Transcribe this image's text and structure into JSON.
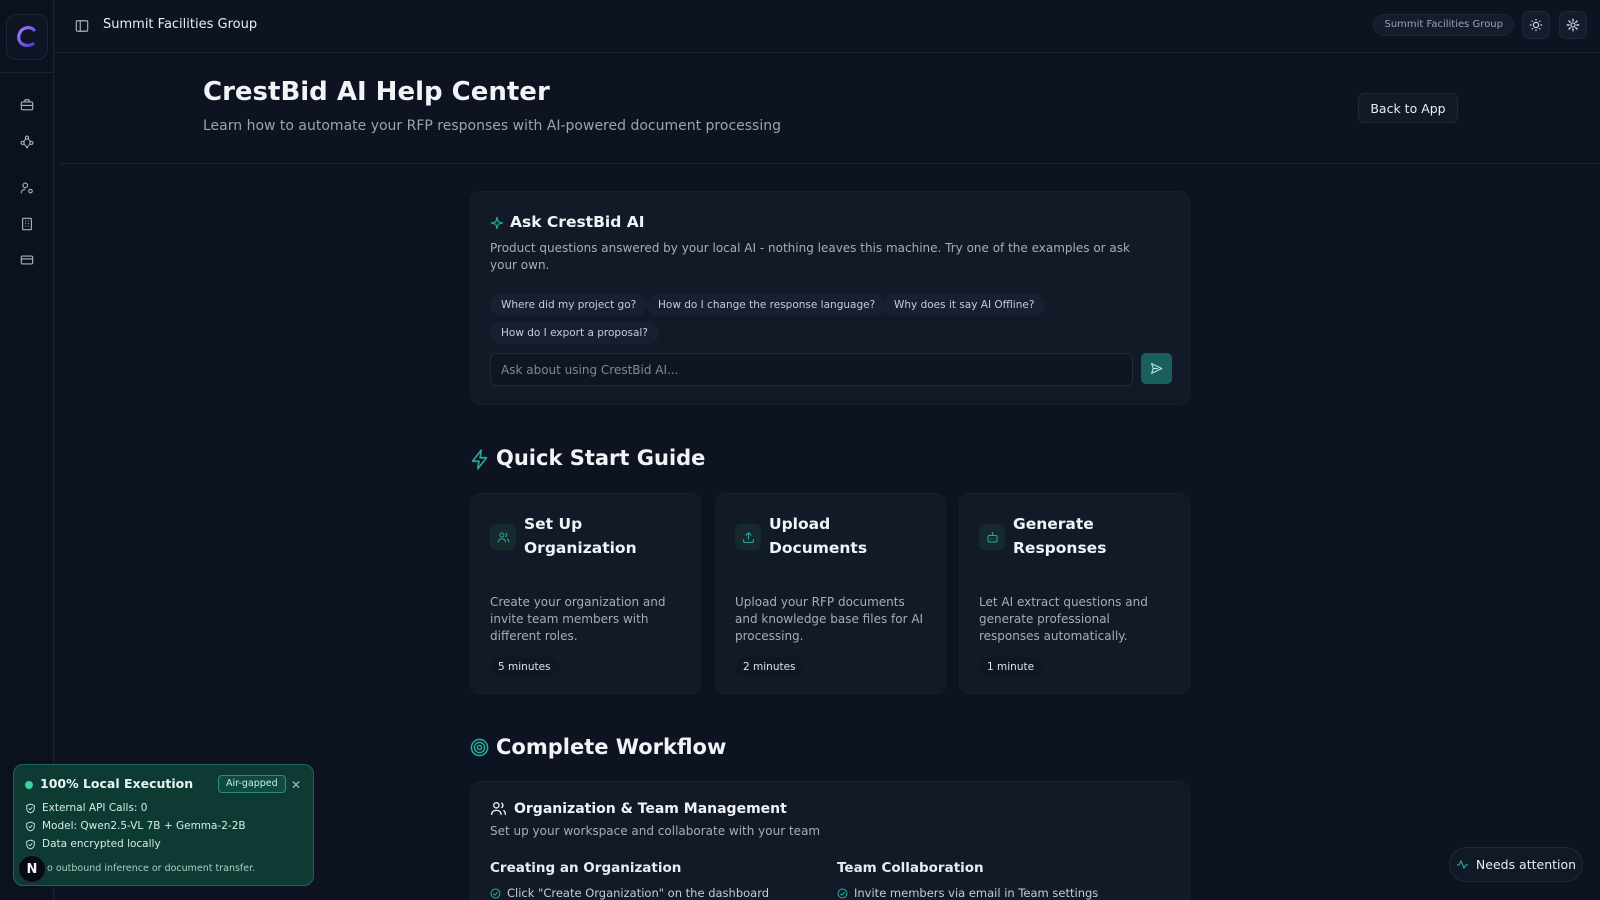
{
  "header": {
    "org_title": "Summit Facilities Group",
    "org_pill": "Summit Facilities Group"
  },
  "page": {
    "title": "CrestBid AI Help Center",
    "subtitle": "Learn how to automate your RFP responses with AI-powered document processing",
    "back_label": "Back to App"
  },
  "ask": {
    "title": "Ask CrestBid AI",
    "description": "Product questions answered by your local AI - nothing leaves this machine. Try one of the examples or ask your own.",
    "chips": [
      "Where did my project go?",
      "How do I change the response language?",
      "Why does it say AI Offline?",
      "How do I export a proposal?"
    ],
    "placeholder": "Ask about using CrestBid AI..."
  },
  "quick_start": {
    "heading": "Quick Start Guide",
    "steps": [
      {
        "title": "Set Up Organization",
        "description": "Create your organization and invite team members with different roles.",
        "time": "5 minutes",
        "icon": "users-icon"
      },
      {
        "title": "Upload Documents",
        "description": "Upload your RFP documents and knowledge base files for AI processing.",
        "time": "2 minutes",
        "icon": "upload-icon"
      },
      {
        "title": "Generate Responses",
        "description": "Let AI extract questions and generate professional responses automatically.",
        "time": "1 minute",
        "icon": "bot-icon"
      }
    ]
  },
  "workflow": {
    "heading": "Complete Workflow",
    "card_title": "Organization & Team Management",
    "card_subtitle": "Set up your workspace and collaborate with your team",
    "columns": [
      {
        "heading": "Creating an Organization",
        "item": "Click \"Create Organization\" on the dashboard"
      },
      {
        "heading": "Team Collaboration",
        "item": "Invite members via email in Team settings"
      }
    ]
  },
  "local_exec": {
    "title": "100% Local Execution",
    "badge": "Air-gapped",
    "rows": [
      "External API Calls: 0",
      "Model: Qwen2.5-VL 7B + Gemma-2-2B",
      "Data encrypted locally"
    ],
    "note": "o outbound inference or document transfer.",
    "avatar_letter": "N"
  },
  "attention": {
    "label": "Needs attention"
  },
  "colors": {
    "background": "#0d1321",
    "card": "#121a28",
    "accent_teal": "#2aa89a",
    "local_panel": "#0d3b34",
    "logo_purple": "#7b5cf0"
  }
}
